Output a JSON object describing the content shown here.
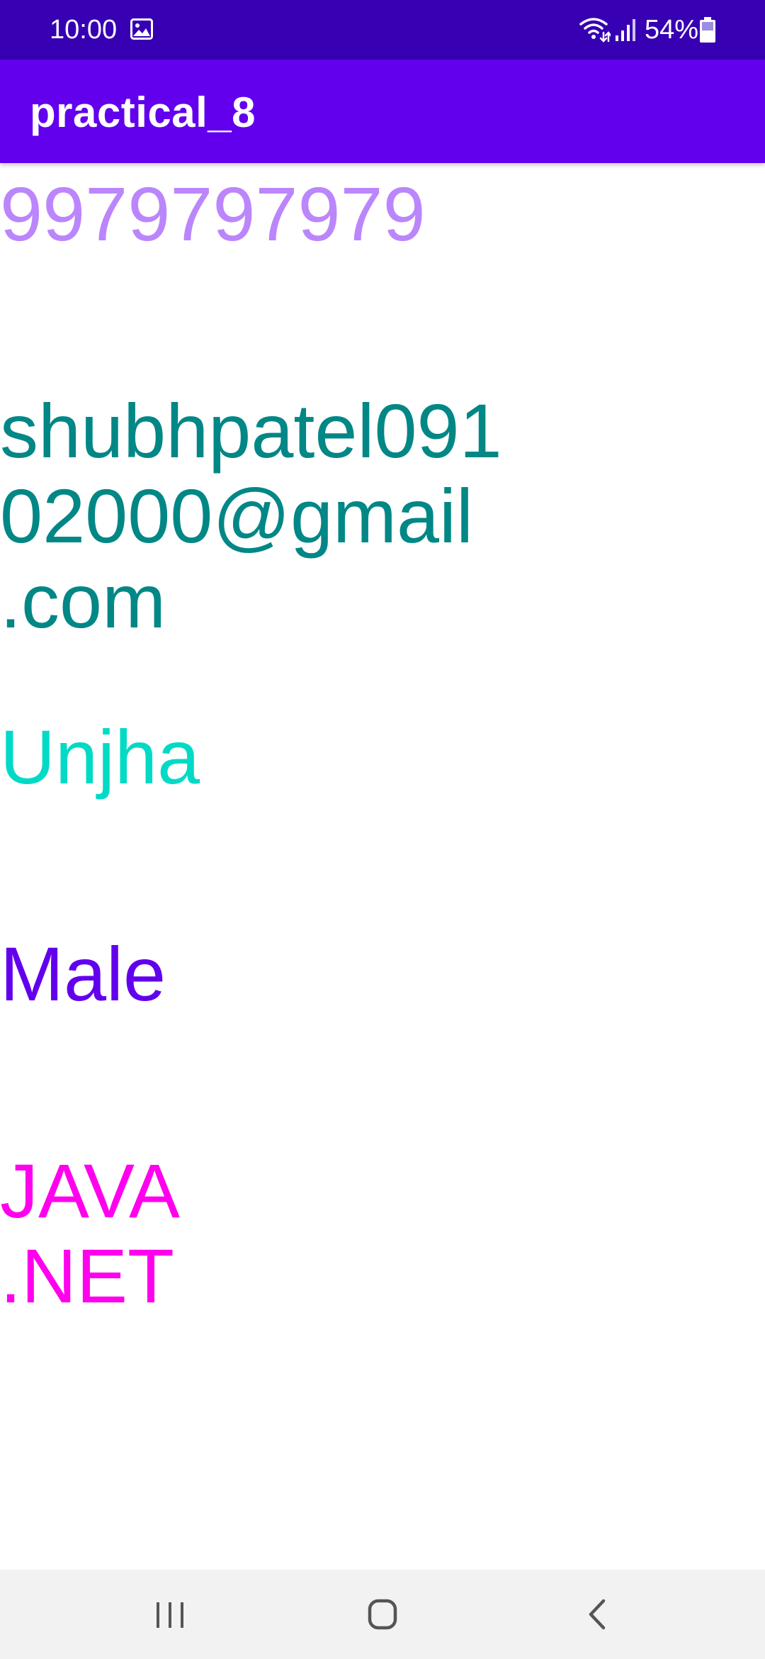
{
  "status_bar": {
    "time": "10:00",
    "battery_percent": "54%",
    "icons": [
      "gallery-icon",
      "wifi-icon",
      "signal-icon",
      "battery-icon"
    ],
    "background_color": "#3700b3"
  },
  "app_bar": {
    "title": "practical_8",
    "background_color": "#6200ee"
  },
  "content": {
    "phone": {
      "text": "9979797979",
      "color": "#bb86fc"
    },
    "email": {
      "text": "shubhpatel091\n02000@gmail\n.com",
      "color": "#018786"
    },
    "city": {
      "text": "Unjha",
      "color": "#03dac5"
    },
    "gender": {
      "text": "Male",
      "color": "#6200ee"
    },
    "languages": {
      "text": "JAVA\n.NET",
      "color": "#ff00ee"
    }
  },
  "nav_bar": {
    "icons": [
      "recents-icon",
      "home-icon",
      "back-icon"
    ],
    "background_color": "#f2f2f2"
  }
}
